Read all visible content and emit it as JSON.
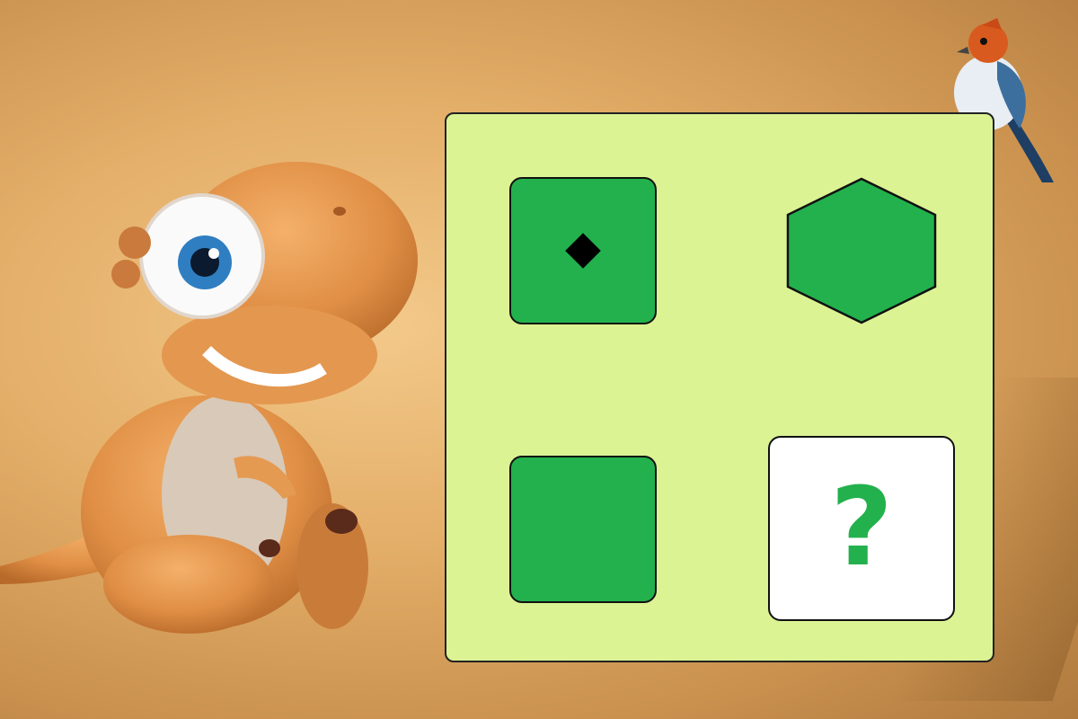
{
  "puzzle": {
    "answer_placeholder": "?",
    "colors": {
      "board": "#dcf394",
      "tile": "#23b14d",
      "answer_tile": "#ffffff",
      "mark": "#000000"
    },
    "tiles": [
      {
        "shape": "rounded-square",
        "mark": "diamond"
      },
      {
        "shape": "hexagon",
        "mark": "none"
      },
      {
        "shape": "rounded-square",
        "mark": "none"
      },
      {
        "shape": "answer",
        "mark": "question-mark"
      }
    ]
  },
  "decorations": {
    "characters": [
      "cartoon-dinosaur",
      "bird"
    ]
  }
}
